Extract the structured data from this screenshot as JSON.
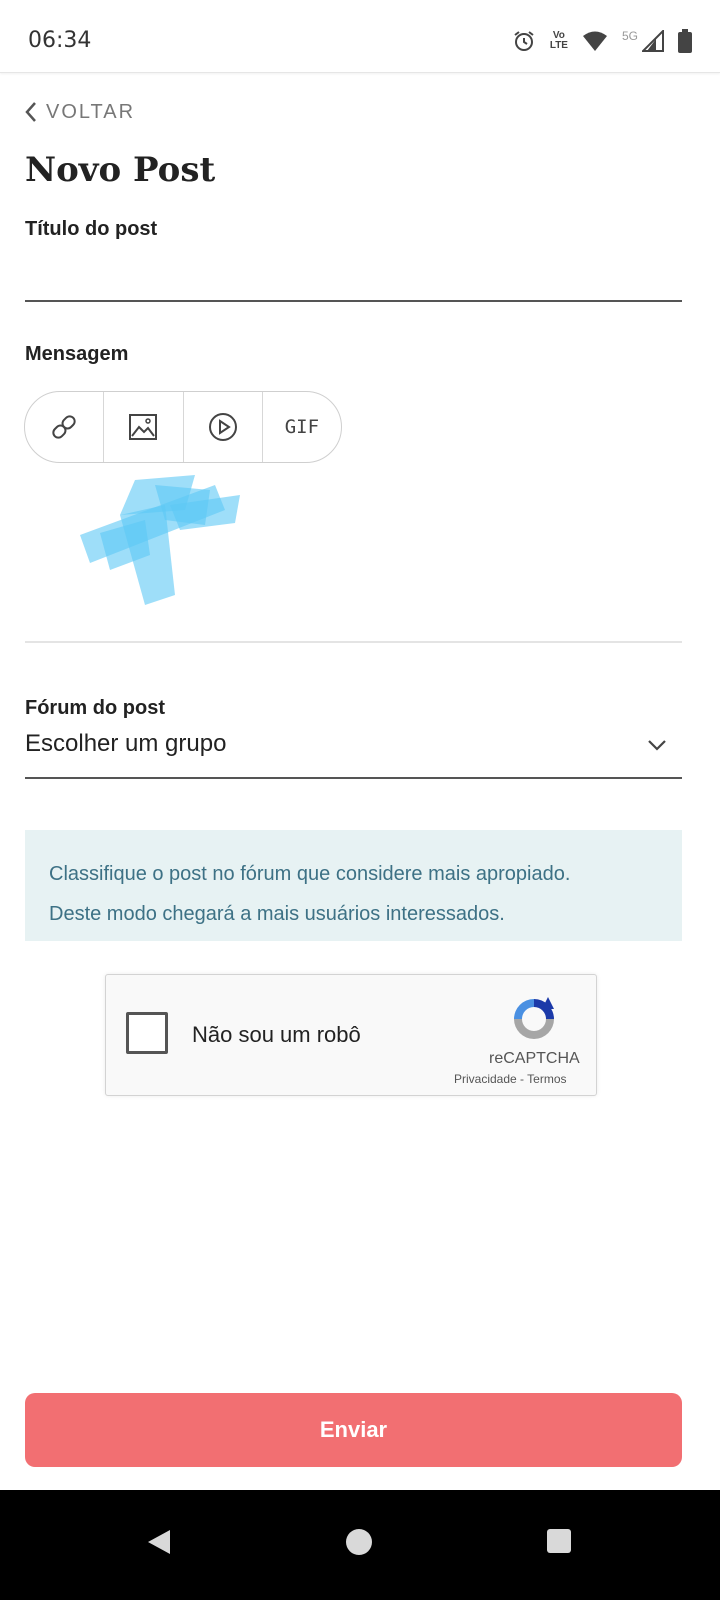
{
  "status_bar": {
    "time": "06:34",
    "network": "5G",
    "icons": [
      "alarm-icon",
      "volte-icon",
      "wifi-icon",
      "signal-icon",
      "battery-icon"
    ]
  },
  "header": {
    "back_label": "VOLTAR",
    "title": "Novo Post"
  },
  "form": {
    "title_label": "Título do post",
    "title_value": "",
    "message_label": "Mensagem",
    "toolbar": [
      {
        "icon": "link-icon"
      },
      {
        "icon": "image-icon"
      },
      {
        "icon": "video-icon"
      },
      {
        "label": "GIF"
      }
    ],
    "forum_label": "Fórum do post",
    "forum_value": "Escolher um grupo",
    "info_line1": "Classifique o post no fórum que considere mais apropiado.",
    "info_line2": "Deste modo chegará a mais usuários interessados."
  },
  "captcha": {
    "label": "Não sou um robô",
    "brand": "reCAPTCHA",
    "privacy": "Privacidade",
    "separator": " - ",
    "terms": "Termos"
  },
  "submit_label": "Enviar",
  "colors": {
    "accent": "#f26f72",
    "info_bg": "#e7f2f3",
    "info_text": "#3d7185",
    "scribble": "#5ec8f5"
  }
}
